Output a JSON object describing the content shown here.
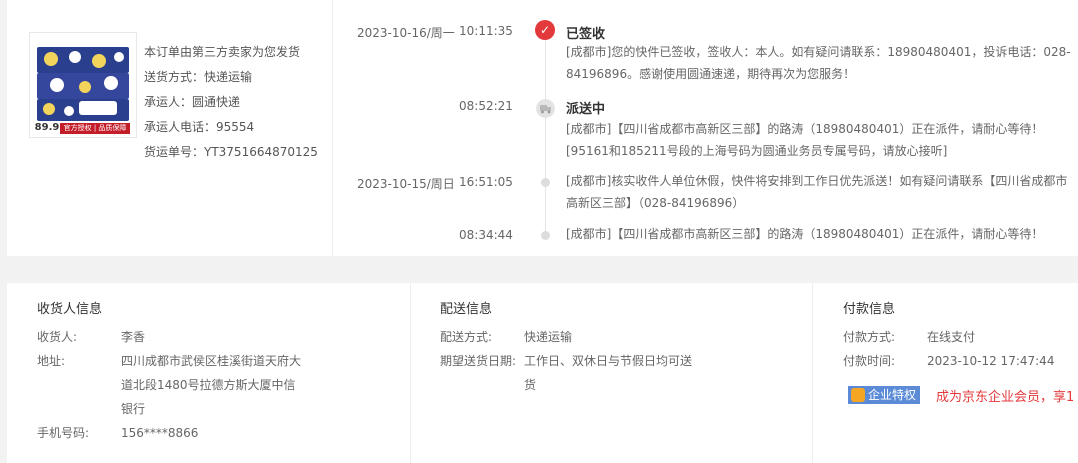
{
  "product": {
    "price": "89.9",
    "badge": "官方授权 | 品质保障"
  },
  "seller": {
    "notice": "本订单由第三方卖家为您发货",
    "delivery_method": "送货方式：快递运输",
    "carrier": "承运人：圆通快递",
    "carrier_phone": "承运人电话：95554",
    "tracking_no": "货运单号：YT3751664870125"
  },
  "tracking": [
    {
      "date": "2023-10-16/周一",
      "time": "10:11:35",
      "status": "已签收",
      "text": "[成都市]您的快件已签收，签收人：本人。如有疑问请联系：18980480401，投诉电话：028-84196896。感谢使用圆通速递，期待再次为您服务！"
    },
    {
      "date": "",
      "time": "08:52:21",
      "status": "派送中",
      "text": "[成都市]【四川省成都市高新区三部】的路涛（18980480401）正在派件，请耐心等待！[95161和185211号段的上海号码为圆通业务员专属号码，请放心接听]"
    },
    {
      "date": "2023-10-15/周日",
      "time": "16:51:05",
      "status": "",
      "text": "[成都市]核实收件人单位休假，快件将安排到工作日优先派送！如有疑问请联系【四川省成都市高新区三部】（028-84196896）"
    },
    {
      "date": "",
      "time": "08:34:44",
      "status": "",
      "text": "[成都市]【四川省成都市高新区三部】的路涛（18980480401）正在派件，请耐心等待！[95161和"
    }
  ],
  "receiver": {
    "title": "收货人信息",
    "name_label": "收货人:",
    "name": "李香",
    "address_label": "地址:",
    "address": "四川成都市武侯区桂溪街道天府大道北段1480号拉德方斯大厦中信银行",
    "phone_label": "手机号码:",
    "phone": "156****8866"
  },
  "delivery": {
    "title": "配送信息",
    "method_label": "配送方式:",
    "method": "快递运输",
    "date_label": "期望送货日期:",
    "date": "工作日、双休日与节假日均可送货"
  },
  "payment": {
    "title": "付款信息",
    "method_label": "付款方式:",
    "method": "在线支付",
    "time_label": "付款时间:",
    "time": "2023-10-12 17:47:44",
    "enterprise_badge": "企业特权",
    "enterprise_text": "成为京东企业会员，享1"
  }
}
